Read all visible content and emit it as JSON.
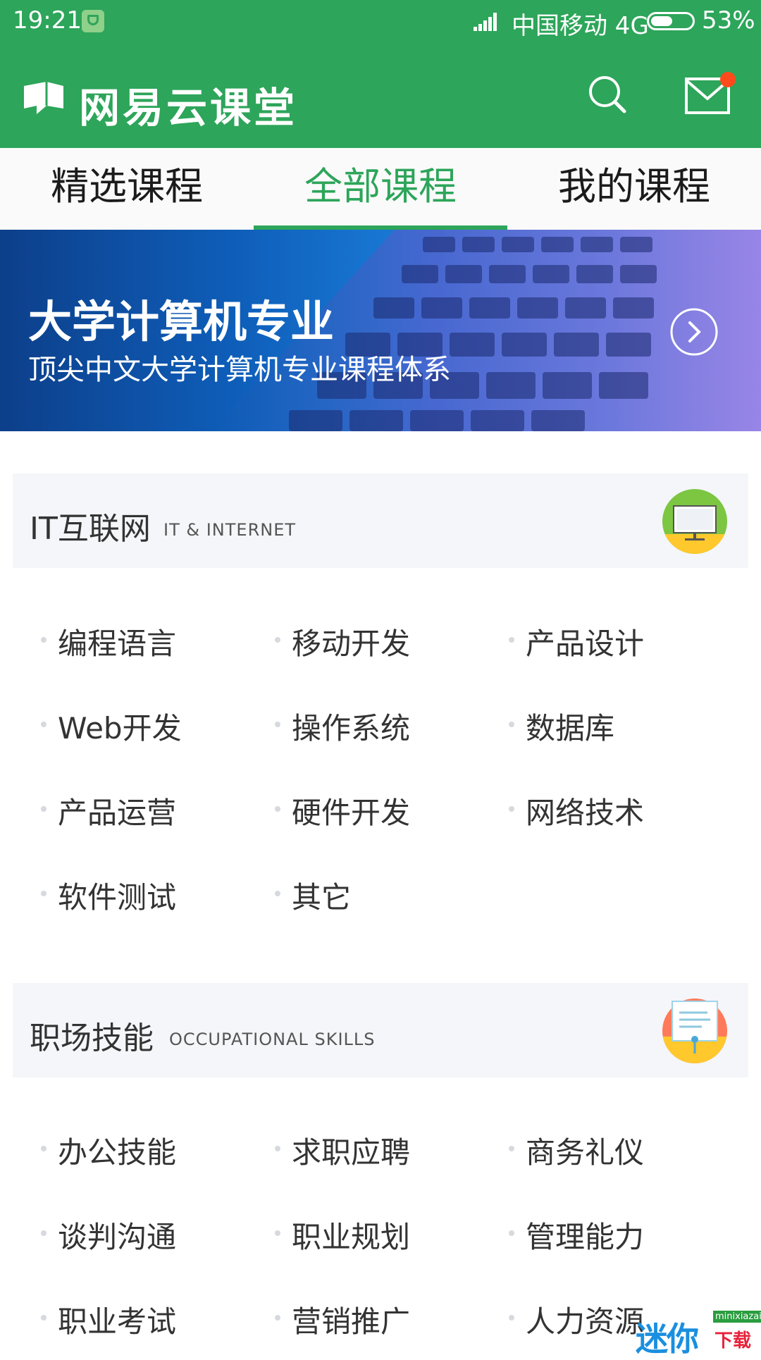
{
  "status": {
    "time": "19:21",
    "carrier": "中国移动 4G",
    "battery": "53%"
  },
  "appbar": {
    "brand": "网易云课堂"
  },
  "tabs": [
    {
      "label": "精选课程"
    },
    {
      "label": "全部课程"
    },
    {
      "label": "我的课程"
    }
  ],
  "banner": {
    "title": "大学计算机专业",
    "subtitle": "顶尖中文大学计算机专业课程体系"
  },
  "sections": [
    {
      "title": "IT互联网",
      "subtitle": "IT & INTERNET",
      "items": [
        "编程语言",
        "移动开发",
        "产品设计",
        "Web开发",
        "操作系统",
        "数据库",
        "产品运营",
        "硬件开发",
        "网络技术",
        "软件测试",
        "其它"
      ]
    },
    {
      "title": "职场技能",
      "subtitle": "OCCUPATIONAL SKILLS",
      "items": [
        "办公技能",
        "求职应聘",
        "商务礼仪",
        "谈判沟通",
        "职业规划",
        "管理能力",
        "职业考试",
        "营销推广",
        "人力资源"
      ]
    }
  ],
  "watermark": {
    "main": "迷你",
    "sub": "minixiazai",
    "tag": "下载"
  },
  "colors": {
    "brand_green": "#2da55a",
    "notification": "#ff4a1c"
  }
}
